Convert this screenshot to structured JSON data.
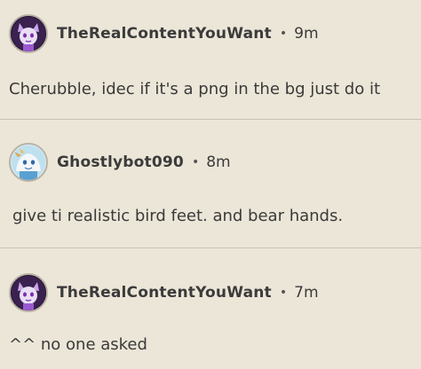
{
  "comments": [
    {
      "username": "TheRealContentYouWant",
      "separator": "•",
      "time": "9m",
      "text": "Cherubble, idec if it's a png in the bg just do it",
      "avatar_icon": "purple-character-avatar-icon"
    },
    {
      "username": "Ghostlybot090",
      "separator": "•",
      "time": "8m",
      "text": "give ti realistic bird feet. and bear hands.",
      "avatar_icon": "ghost-character-avatar-icon"
    },
    {
      "username": "TheRealContentYouWant",
      "separator": "•",
      "time": "7m",
      "text": "^^ no one asked",
      "avatar_icon": "purple-character-avatar-icon"
    }
  ],
  "colors": {
    "background": "#ece6d8",
    "divider": "#c9c2b3",
    "text": "#3a3a3a"
  }
}
